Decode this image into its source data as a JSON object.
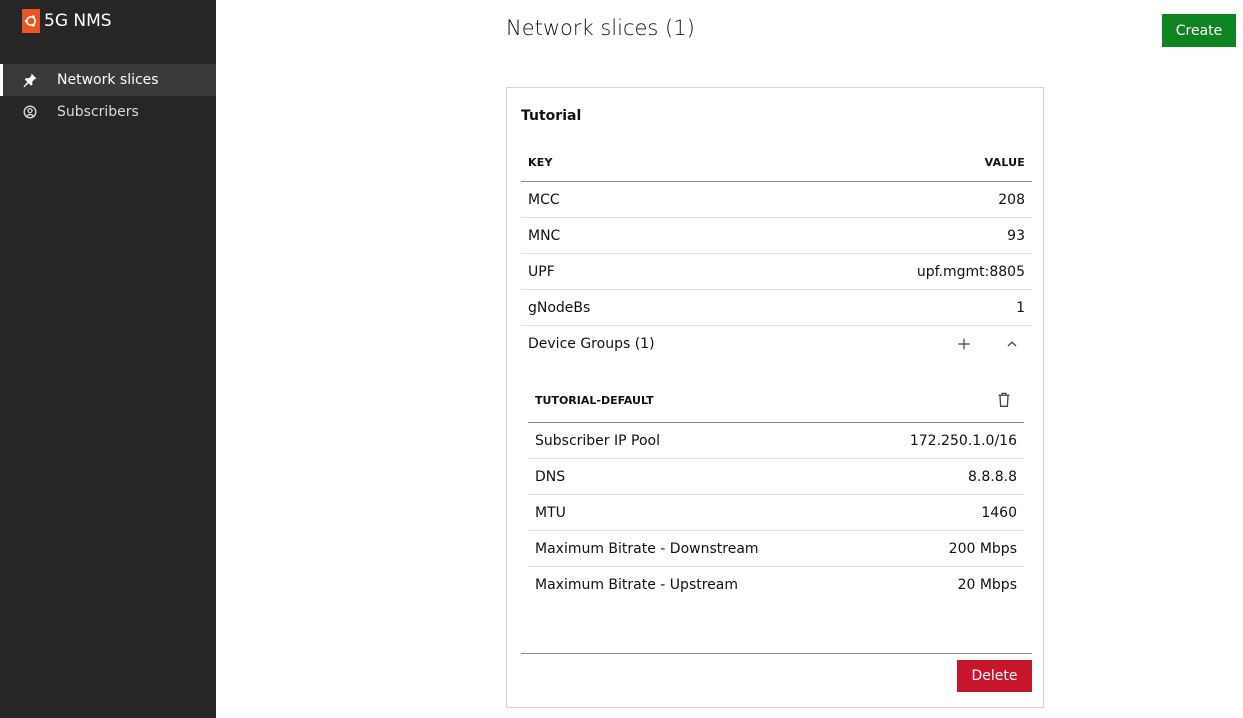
{
  "app": {
    "name": "5G NMS"
  },
  "sidebar": {
    "items": [
      {
        "label": "Network slices",
        "icon": "pin-icon",
        "active": true
      },
      {
        "label": "Subscribers",
        "icon": "user-circle-icon",
        "active": false
      }
    ]
  },
  "header": {
    "title": "Network slices (1)",
    "create_label": "Create"
  },
  "slice": {
    "name": "Tutorial",
    "table": {
      "key_header": "KEY",
      "value_header": "VALUE",
      "rows": [
        {
          "key": "MCC",
          "value": "208"
        },
        {
          "key": "MNC",
          "value": "93"
        },
        {
          "key": "UPF",
          "value": "upf.mgmt:8805"
        },
        {
          "key": "gNodeBs",
          "value": "1"
        }
      ]
    },
    "device_groups": {
      "label": "Device Groups (1)",
      "group": {
        "name": "TUTORIAL-DEFAULT",
        "rows": [
          {
            "key": "Subscriber IP Pool",
            "value": "172.250.1.0/16"
          },
          {
            "key": "DNS",
            "value": "8.8.8.8"
          },
          {
            "key": "MTU",
            "value": "1460"
          },
          {
            "key": "Maximum Bitrate - Downstream",
            "value": "200 Mbps"
          },
          {
            "key": "Maximum Bitrate - Upstream",
            "value": "20 Mbps"
          }
        ]
      }
    },
    "delete_label": "Delete"
  },
  "colors": {
    "sidebar_bg": "#262626",
    "create_button": "#0e8420",
    "delete_button": "#c7162b",
    "logo": "#e95420"
  }
}
